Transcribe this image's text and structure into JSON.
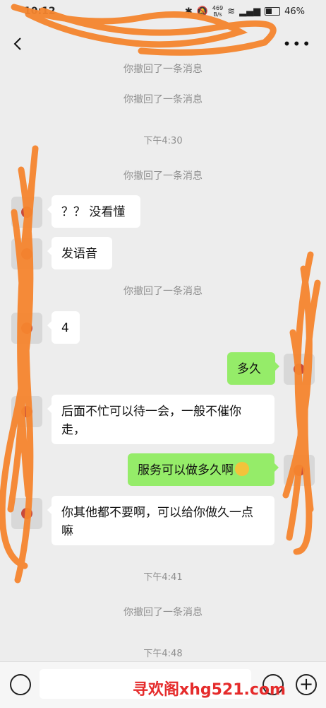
{
  "status_bar": {
    "time": "10:12",
    "net_speed_value": "469",
    "net_speed_unit": "B/s",
    "battery": "46%"
  },
  "header": {
    "title": ""
  },
  "messages": [
    {
      "type": "system",
      "text": "你撤回了一条消息"
    },
    {
      "type": "system",
      "text": "你撤回了一条消息"
    },
    {
      "type": "time",
      "text": "下午4:30"
    },
    {
      "type": "system",
      "text": "你撤回了一条消息"
    },
    {
      "type": "in",
      "text": "？？ 没看懂"
    },
    {
      "type": "in",
      "text": "发语音"
    },
    {
      "type": "system",
      "text": "你撤回了一条消息"
    },
    {
      "type": "in",
      "text": "4"
    },
    {
      "type": "out",
      "text": "多久"
    },
    {
      "type": "in",
      "text": "后面不忙可以待一会，一般不催你走，"
    },
    {
      "type": "out",
      "text": "服务可以做多久啊"
    },
    {
      "type": "in",
      "text": "你其他都不要啊，可以给你做久一点嘛"
    },
    {
      "type": "time",
      "text": "下午4:41"
    },
    {
      "type": "system",
      "text": "你撤回了一条消息"
    },
    {
      "type": "time",
      "text": "下午4:48"
    }
  ],
  "watermark": "寻欢阁xhg521.com",
  "colors": {
    "background": "#ededed",
    "outgoing_bubble": "#95ec69",
    "incoming_bubble": "#ffffff",
    "scribble": "#f5852e"
  }
}
